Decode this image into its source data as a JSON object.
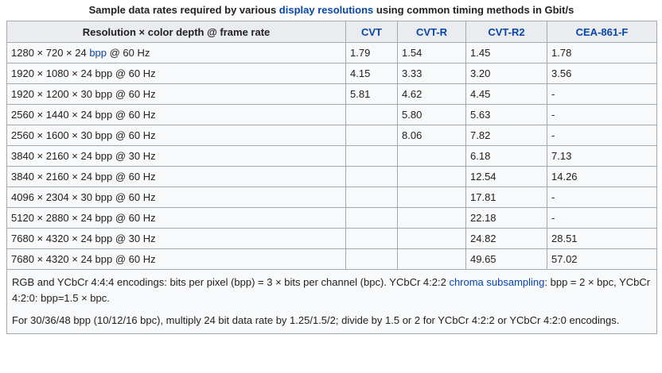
{
  "caption": {
    "before": "Sample data rates required by various ",
    "link": "display resolutions",
    "after": " using common timing methods in Gbit/s"
  },
  "headers": {
    "resolution": "Resolution × color depth @ frame rate",
    "cvt": "CVT",
    "cvt_r": "CVT-R",
    "cvt_r2": "CVT-R2",
    "cea": "CEA-861-F"
  },
  "rows": [
    {
      "res_before": "1280 × 720 × 24 ",
      "res_link": "bpp",
      "res_after": " @ 60 Hz",
      "cvt": "1.79",
      "cvt_r": "1.54",
      "cvt_r2": "1.45",
      "cea": "1.78"
    },
    {
      "res_before": "1920 × 1080 × 24 bpp @ 60 Hz",
      "cvt": "4.15",
      "cvt_r": "3.33",
      "cvt_r2": "3.20",
      "cea": "3.56"
    },
    {
      "res_before": "1920 × 1200 × 30 bpp @ 60 Hz",
      "cvt": "5.81",
      "cvt_r": "4.62",
      "cvt_r2": "4.45",
      "cea": "-"
    },
    {
      "res_before": "2560 × 1440 × 24 bpp @ 60 Hz",
      "cvt": "",
      "cvt_r": "5.80",
      "cvt_r2": "5.63",
      "cea": "-"
    },
    {
      "res_before": "2560 × 1600 × 30 bpp @ 60 Hz",
      "cvt": "",
      "cvt_r": "8.06",
      "cvt_r2": "7.82",
      "cea": "-"
    },
    {
      "res_before": "3840 × 2160 × 24 bpp @ 30 Hz",
      "cvt": "",
      "cvt_r": "",
      "cvt_r2": "6.18",
      "cea": "7.13"
    },
    {
      "res_before": "3840 × 2160 × 24 bpp @ 60 Hz",
      "cvt": "",
      "cvt_r": "",
      "cvt_r2": "12.54",
      "cea": "14.26"
    },
    {
      "res_before": "4096 × 2304 × 30 bpp @ 60 Hz",
      "cvt": "",
      "cvt_r": "",
      "cvt_r2": "17.81",
      "cea": "-"
    },
    {
      "res_before": "5120 × 2880 × 24 bpp @ 60 Hz",
      "cvt": "",
      "cvt_r": "",
      "cvt_r2": "22.18",
      "cea": "-"
    },
    {
      "res_before": "7680 × 4320 × 24 bpp @ 30 Hz",
      "cvt": "",
      "cvt_r": "",
      "cvt_r2": "24.82",
      "cea": "28.51"
    },
    {
      "res_before": "7680 × 4320 × 24 bpp @ 60 Hz",
      "cvt": "",
      "cvt_r": "",
      "cvt_r2": "49.65",
      "cea": "57.02"
    }
  ],
  "notes": {
    "note1_before": "RGB and YCbCr 4:4:4 encodings: bits per pixel (bpp) = 3 × bits per channel (bpc). YCbCr 4:2:2 ",
    "note1_link": "chroma subsampling",
    "note1_after": ": bpp = 2 × bpc, YCbCr 4:2:0: bpp=1.5 × bpc.",
    "note2": "For 30/36/48 bpp (10/12/16 bpc), multiply 24 bit data rate by 1.25/1.5/2; divide by 1.5 or 2 for YCbCr 4:2:2 or YCbCr 4:2:0 encodings."
  }
}
